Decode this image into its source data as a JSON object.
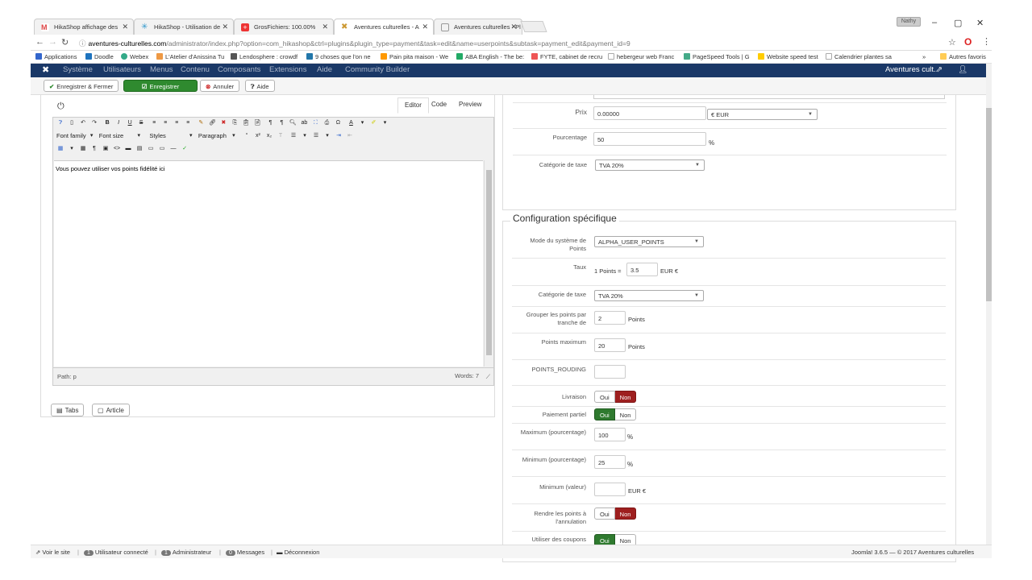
{
  "browser": {
    "tabs": [
      {
        "label": "HikaShop affichage des",
        "icon_color": "#d44"
      },
      {
        "label": "HikaShop - Utilisation de",
        "icon_color": "#39c"
      },
      {
        "label": "GrosFichiers: 100.00%",
        "icon_color": "#e33"
      },
      {
        "label": "Aventures culturelles - A",
        "icon_color": "#c93"
      },
      {
        "label": "Aventures culturelles - Pl",
        "icon_color": "#999"
      }
    ],
    "user_chip": "Nathy",
    "minimize": "–",
    "maximize": "▢",
    "close": "✕",
    "url_host": "aventures-culturelles.com",
    "url_rest": "/administrator/index.php?option=com_hikashop&ctrl=plugins&plugin_type=payment&task=edit&name=userpoints&subtask=payment_edit&payment_id=9",
    "bookmarks": [
      {
        "label": "Applications",
        "color": "#3366cc"
      },
      {
        "label": "Doodle",
        "color": "#1e73be"
      },
      {
        "label": "Webex",
        "color": "#3a8"
      },
      {
        "label": "L'Atelier d'Anissina Tu",
        "color": "#e94"
      },
      {
        "label": "Lendosphere : crowdf",
        "color": "#555"
      },
      {
        "label": "9 choses que l'on ne",
        "color": "#27a"
      },
      {
        "label": "Pain pita maison - We",
        "color": "#f90"
      },
      {
        "label": "ABA English - The be:",
        "color": "#2a6"
      },
      {
        "label": "FYTE, cabinet de recru",
        "color": "#e55"
      },
      {
        "label": "hebergeur web Franc",
        "color": "#aaa"
      },
      {
        "label": "PageSpeed Tools | G",
        "color": "#4a8"
      },
      {
        "label": "Website speed test",
        "color": "#fc0"
      },
      {
        "label": "Calendrier plantes sa",
        "color": "#aaa"
      },
      {
        "label": "Autres favoris",
        "color": "#fc5"
      }
    ]
  },
  "joomla_nav": {
    "items": [
      "Système",
      "Utilisateurs",
      "Menus",
      "Contenu",
      "Composants",
      "Extensions",
      "Aide",
      "Community Builder"
    ],
    "site_name": "Aventures cult..",
    "user_icon": "user-icon"
  },
  "toolbar": {
    "save_close": "Enregistrer & Fermer",
    "save": "Enregistrer",
    "cancel": "Annuler",
    "help": "Aide"
  },
  "editor": {
    "tabs": [
      "Editor",
      "Code",
      "Preview"
    ],
    "font_family": "Font family",
    "font_size": "Font size",
    "styles": "Styles",
    "paragraph": "Paragraph",
    "content": "Vous pouvez utiliser vos points fidélité ici",
    "path": "Path: p",
    "words": "Words: 7",
    "btn_tabs": "Tabs",
    "btn_article": "Article"
  },
  "main_form": {
    "prix_label": "Prix",
    "prix_value": "0.00000",
    "currency": "€ EUR",
    "pourcentage_label": "Pourcentage",
    "pourcentage_value": "50",
    "pourcentage_unit": "%",
    "taxe_label": "Catégorie de taxe",
    "taxe_value": "TVA 20%"
  },
  "specific": {
    "legend": "Configuration spécifique",
    "mode_label": "Mode du système de Points",
    "mode_value": "ALPHA_USER_POINTS",
    "taux_label": "Taux",
    "taux_prefix": "1 Points =",
    "taux_value": "3.5",
    "taux_unit": "EUR €",
    "taxe_label": "Catégorie de taxe",
    "taxe_value": "TVA 20%",
    "grouper_label": "Grouper les points par tranche de",
    "grouper_value": "2",
    "grouper_unit": "Points",
    "max_points_label": "Points maximum",
    "max_points_value": "20",
    "max_points_unit": "Points",
    "rouding_label": "POINTS_ROUDING",
    "rouding_value": "",
    "livraison_label": "Livraison",
    "paiement_label": "Paiement partiel",
    "max_pct_label": "Maximum (pourcentage)",
    "max_pct_value": "100",
    "min_pct_label": "Minimum (pourcentage)",
    "min_pct_value": "25",
    "pct_unit": "%",
    "min_val_label": "Minimum (valeur)",
    "min_val_value": "",
    "min_val_unit": "EUR €",
    "rendre_label": "Rendre les points à l'annulation",
    "coupons_label": "Utiliser des coupons virtuels",
    "oui": "Oui",
    "non": "Non"
  },
  "footer": {
    "voir_site": "Voir le site",
    "users_count": "1",
    "users_label": "Utilisateur connecté",
    "admin_count": "1",
    "admin_label": "Administrateur",
    "msg_count": "0",
    "msg_label": "Messages",
    "logout": "Déconnexion",
    "version": "Joomla! 3.6.5 — © 2017 Aventures culturelles"
  },
  "colors": {
    "joomla_nav_bg": "#1a3867",
    "green": "#2f8a2f",
    "red": "#9e1f1f"
  }
}
